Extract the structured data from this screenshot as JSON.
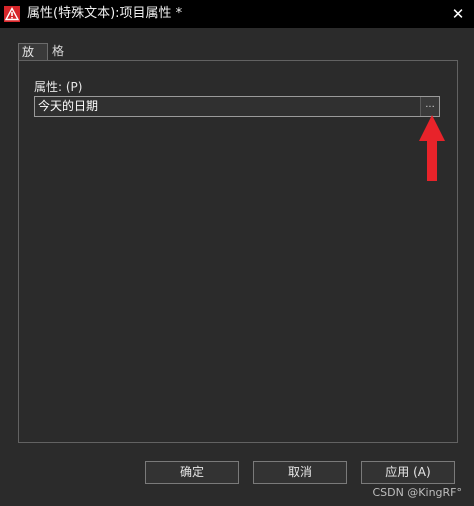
{
  "window": {
    "title": "属性(特殊文本):项目属性 *",
    "app_icon": "autocad-icon",
    "close_glyph": "✕"
  },
  "tabs": [
    {
      "label": "放置",
      "active": true
    },
    {
      "label": "格式",
      "active": false
    }
  ],
  "property": {
    "label": "属性: (P)",
    "value": "今天的日期",
    "ellipsis_label": "..."
  },
  "annotation": {
    "arrow_color": "#e8232a",
    "arrow_icon": "red-arrow-up-icon"
  },
  "buttons": {
    "ok": "确定",
    "cancel": "取消",
    "apply": "应用 (A)"
  },
  "watermark": "CSDN @KingRF°",
  "colors": {
    "titlebar": "#000000",
    "background": "#2b2b2b",
    "accent_red": "#e8232a"
  }
}
